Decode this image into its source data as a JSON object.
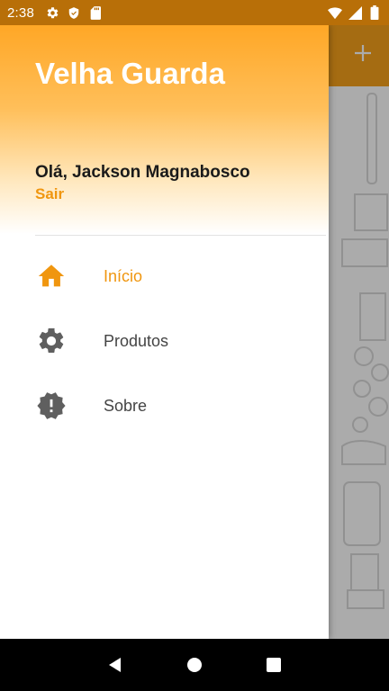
{
  "status_bar": {
    "time": "2:38",
    "left_icons": [
      "gear-icon",
      "shield-icon",
      "sd-card-icon"
    ],
    "right_icons": [
      "wifi-icon",
      "signal-icon",
      "battery-icon"
    ]
  },
  "background_app": {
    "toolbar_color": "#f7a21b",
    "action_icon": "plus-icon"
  },
  "drawer": {
    "title": "Velha Guarda",
    "greeting": "Olá, Jackson Magnabosco",
    "logout_label": "Sair",
    "items": [
      {
        "label": "Início",
        "icon": "home-icon",
        "active": true
      },
      {
        "label": "Produtos",
        "icon": "gear-icon",
        "active": false
      },
      {
        "label": "Sobre",
        "icon": "alert-badge-icon",
        "active": false
      }
    ]
  },
  "colors": {
    "accent": "#f0960f",
    "header_top": "#ffa726",
    "icon_gray": "#5f5f5f"
  },
  "nav_bar": {
    "buttons": [
      "back-icon",
      "home-circle-icon",
      "recents-icon"
    ]
  }
}
